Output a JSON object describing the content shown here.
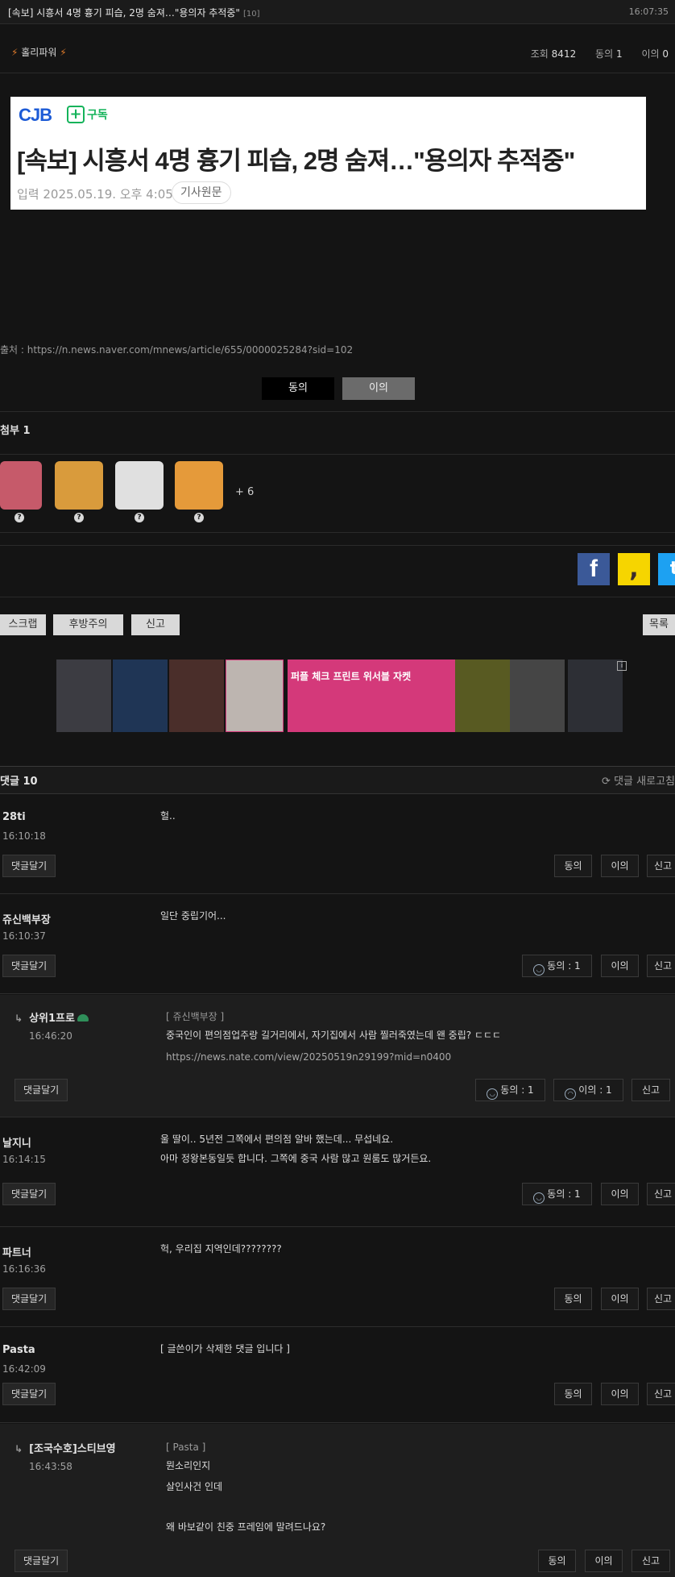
{
  "post": {
    "title": "[속보] 시흥서 4명 흉기 피습, 2명 숨져…\"용의자 추적중\"",
    "comment_count_label": "[10]",
    "time": "16:07:35",
    "author": "홀리파워",
    "stats": {
      "views_label": "조회",
      "views": "8412",
      "agree_label": "동의",
      "agree": "1",
      "disagree_label": "이의",
      "disagree": "0"
    }
  },
  "article_image": {
    "logo": "CJB",
    "subscribe": "구독",
    "headline": "[속보] 시흥서 4명 흉기 피습, 2명 숨져…\"용의자 추적중\"",
    "date": "입력 2025.05.19. 오후 4:05",
    "original_label": "기사원문"
  },
  "source": "출처 : https://n.news.naver.com/mnews/article/655/0000025284?sid=102",
  "vote": {
    "agree": "동의",
    "disagree": "이의"
  },
  "attachments": {
    "label": "첨부 1",
    "more": "+ 6"
  },
  "actions": {
    "scrap": "스크랩",
    "caution": "후방주의",
    "report": "신고",
    "list": "목록"
  },
  "ad": {
    "hero_text": "퍼플 체크 프린트 위서블 자켓",
    "info": "i"
  },
  "comments_header": {
    "title": "댓글 10",
    "refresh": "댓글 새로고침"
  },
  "buttons": {
    "reply": "댓글달기",
    "agree": "동의",
    "disagree": "이의",
    "report": "신고"
  },
  "comments": [
    {
      "name": "28ti",
      "time": "16:10:18",
      "text": "헐.."
    },
    {
      "name": "쥬신백부장",
      "time": "16:10:37",
      "text": "일단 중립기어...",
      "agree": "동의 : 1"
    },
    {
      "name": "상위1프로",
      "time": "16:46:20",
      "quote": "[ 쥬신백부장 ]",
      "text": "중국인이 편의점업주랑 길거리에서, 자기집에서 사람 찔러죽였는데 왠 중립? ㄷㄷㄷ",
      "link": "https://news.nate.com/view/20250519n29199?mid=n0400",
      "agree": "동의 : 1",
      "disagree": "이의 : 1"
    },
    {
      "name": "날지니",
      "time": "16:14:15",
      "text1": "울 딸이.. 5년전 그쪽에서 편의점 알바 했는데... 무섭네요.",
      "text2": "아마 정왕본동일듯 합니다. 그쪽에 중국 사람 많고 원룸도 많거든요.",
      "agree": "동의 : 1"
    },
    {
      "name": "파트너",
      "time": "16:16:36",
      "text": "헉, 우리집 지역인데????????"
    },
    {
      "name": "Pasta",
      "time": "16:42:09",
      "text": "[ 글쓴이가 삭제한 댓글 입니다 ]"
    },
    {
      "name": "[조국수호]스티브영",
      "time": "16:43:58",
      "quote": "[ Pasta ]",
      "text1": "뭔소리인지",
      "text2": "살인사건 인데",
      "text3": "왜 바보같이 친중 프레임에 말려드나요?"
    }
  ],
  "icons": [
    "bolt-icon",
    "facebook-icon",
    "kakaostory-icon",
    "twitter-icon",
    "refresh-icon",
    "smile-icon",
    "frown-icon",
    "reply-arrow-icon"
  ],
  "colors": {
    "background": "#141414",
    "ad_accent": "#d4397a",
    "logo_blue": "#1d5bd6",
    "subscribe_green": "#14b35a"
  }
}
